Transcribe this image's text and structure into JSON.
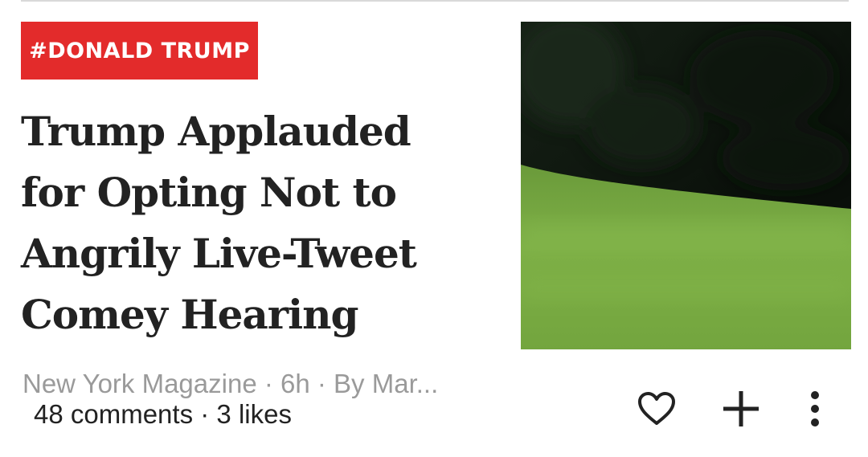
{
  "card": {
    "tag": "#DONALD TRUMP",
    "headline_lines": [
      "Trump Applauded",
      "for Opting Not to",
      "Angrily Live-Tweet",
      "Comey Hearing"
    ],
    "meta": {
      "source": "New York Magazine",
      "age": "6h",
      "byline": "By Mar..."
    },
    "stats": {
      "comments": "48 comments",
      "likes": "3 likes"
    },
    "thumbnail_icon": "golf-course-photo",
    "actions": {
      "like_icon": "heart-outline-icon",
      "add_icon": "plus-icon",
      "more_icon": "more-vertical-icon"
    }
  },
  "colors": {
    "tag_background": "#e32b2b",
    "tag_text": "#ffffff",
    "headline": "#222222",
    "meta": "#9a9a9a",
    "stats": "#222222",
    "divider": "#d9d9d9"
  }
}
